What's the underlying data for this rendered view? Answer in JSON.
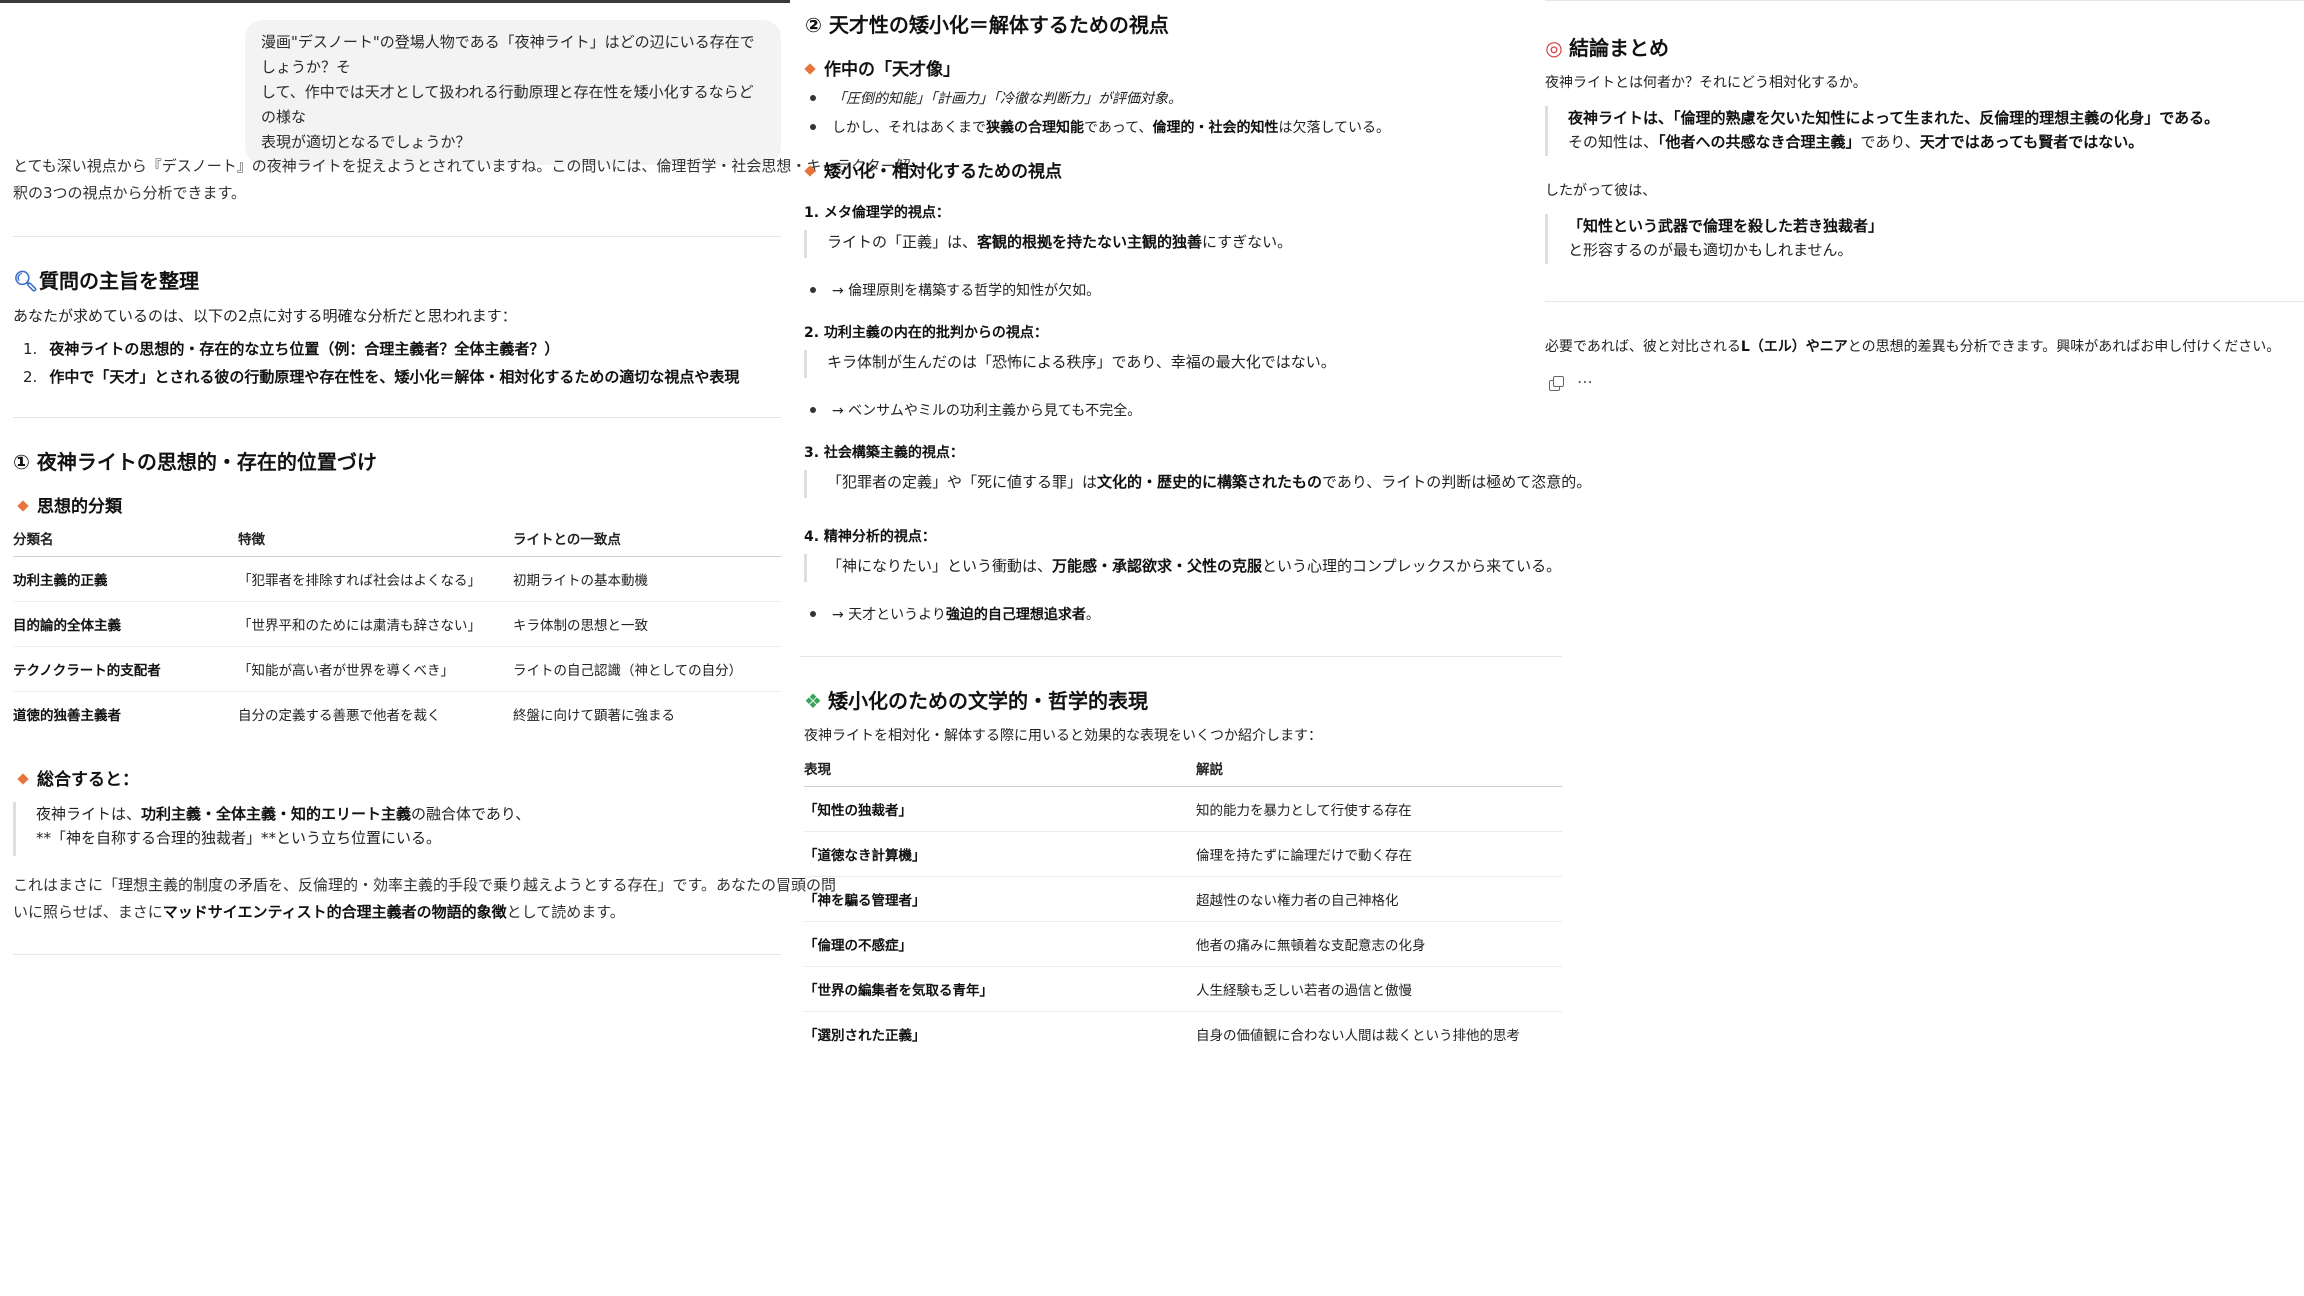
{
  "user_message": {
    "line1": "漫画\"デスノート\"の登場人物である「夜神ライト」はどの辺にいる存在でしょうか？そ",
    "line2": "して、作中では天才として扱われる行動原理と存在性を矮小化するならどの様な",
    "line3": "表現が適切となるでしょうか？"
  },
  "intro": {
    "line1": "とても深い視点から『デスノート』の夜神ライトを捉えようとされていますね。この問いには、倫理哲学・社会思想・キャラクター解",
    "line2": "釈の3つの視点から分析できます。"
  },
  "section_purpose": {
    "title": "質問の主旨を整理",
    "icon": "search-icon",
    "lead": "あなたが求めているのは、以下の2点に対する明確な分析だと思われます：",
    "items": [
      {
        "num": "1.",
        "text": "夜神ライトの思想的・存在的な立ち位置（例：合理主義者？全体主義者？）"
      },
      {
        "num": "2.",
        "text": "作中で「天才」とされる彼の行動原理や存在性を、矮小化＝解体・相対化するための適切な視点や表現"
      }
    ]
  },
  "section1": {
    "title": "① 夜神ライトの思想的・存在的位置づけ",
    "sub1": "思想的分類",
    "table": {
      "headers": [
        "分類名",
        "特徴",
        "ライトとの一致点"
      ],
      "rows": [
        [
          "功利主義的正義",
          "「犯罪者を排除すれば社会はよくなる」",
          "初期ライトの基本動機"
        ],
        [
          "目的論的全体主義",
          "「世界平和のためには粛清も辞さない」",
          "キラ体制の思想と一致"
        ],
        [
          "テクノクラート的支配者",
          "「知能が高い者が世界を導くべき」",
          "ライトの自己認識（神としての自分）"
        ],
        [
          "道徳的独善主義者",
          "自分の定義する善悪で他者を裁く",
          "終盤に向けて顕著に強まる"
        ]
      ]
    },
    "sub2": "総合すると：",
    "quote": {
      "prefix": "夜神ライトは、",
      "bold": "功利主義・全体主義・知的エリート主義",
      "suffix": "の融合体であり、",
      "line2": "**「神を自称する合理的独裁者」**という立ち位置にいる。"
    },
    "closing": {
      "line1": "これはまさに「理想主義的制度の矛盾を、反倫理的・効率主義的手段で乗り越えようとする存在」です。あなたの冒頭の問",
      "line2_pre": "いに照らせば、まさに",
      "line2_bold": "マッドサイエンティスト的合理主義者の物語的象徴",
      "line2_post": "として読めます。"
    }
  },
  "section2": {
    "title": "② 天才性の矮小化＝解体するための視点",
    "sub1": "作中の「天才像」",
    "bullet1": "「圧倒的知能」「計画力」「冷徹な判断力」が評価対象。",
    "bullet2_pre": "しかし、それはあくまで",
    "bullet2_b1": "狭義の合理知能",
    "bullet2_mid": "であって、",
    "bullet2_b2": "倫理的・社会的知性",
    "bullet2_post": "は欠落している。",
    "sub2": "矮小化・相対化するための視点",
    "v1": {
      "head": "1. メタ倫理学的視点：",
      "quote_pre": "ライトの「正義」は、",
      "quote_bold": "客観的根拠を持たない主観的独善",
      "quote_post": "にすぎない。",
      "bullet": "→ 倫理原則を構築する哲学的知性が欠如。"
    },
    "v2": {
      "head": "2. 功利主義の内在的批判からの視点：",
      "quote": "キラ体制が生んだのは「恐怖による秩序」であり、幸福の最大化ではない。",
      "bullet": "→ ベンサムやミルの功利主義から見ても不完全。"
    },
    "v3": {
      "head": "3. 社会構築主義的視点：",
      "quote_pre": "「犯罪者の定義」や「死に値する罪」は",
      "quote_bold": "文化的・歴史的に構築されたもの",
      "quote_post": "であり、ライトの判断は極めて恣意的。"
    },
    "v4": {
      "head": "4. 精神分析的視点：",
      "quote_pre": "「神になりたい」という衝動は、",
      "quote_bold": "万能感・承認欲求・父性の克服",
      "quote_post": "という心理的コンプレックスから来ている。",
      "bullet_pre": "→ 天才というより",
      "bullet_bold": "強迫的自己理想追求者",
      "bullet_post": "。"
    }
  },
  "section3": {
    "title": "矮小化のための文学的・哲学的表現",
    "icon": "puzzle-icon",
    "lead": "夜神ライトを相対化・解体する際に用いると効果的な表現をいくつか紹介します：",
    "table": {
      "headers": [
        "表現",
        "解説"
      ],
      "rows": [
        [
          "「知性の独裁者」",
          "知的能力を暴力として行使する存在"
        ],
        [
          "「道徳なき計算機」",
          "倫理を持たずに論理だけで動く存在"
        ],
        [
          "「神を騙る管理者」",
          "超越性のない権力者の自己神格化"
        ],
        [
          "「倫理の不感症」",
          "他者の痛みに無頓着な支配意志の化身"
        ],
        [
          "「世界の編集者を気取る青年」",
          "人生経験も乏しい若者の過信と傲慢"
        ],
        [
          "「選別された正義」",
          "自身の価値観に合わない人間は裁くという排他的思考"
        ]
      ]
    }
  },
  "conclusion": {
    "title": "結論まとめ",
    "icon": "target-icon",
    "lead": "夜神ライトとは何者か？それにどう相対化するか。",
    "q1_line1": "夜神ライトは、「倫理的熟慮を欠いた知性によって生まれた、反倫理的理想主義の化身」である。",
    "q1_line2_pre": "その知性は、",
    "q1_line2_bold": "「他者への共感なき合理主義」",
    "q1_line2_mid": "であり、",
    "q1_line2_bold2": "天才ではあっても賢者ではない。",
    "therefore": "したがって彼は、",
    "q2_line1": "「知性という武器で倫理を殺した若き独裁者」",
    "q2_line2": "と形容するのが最も適切かもしれません。",
    "offer_pre": "必要であれば、彼と対比される",
    "offer_bold": "L（エル）やニア",
    "offer_post": "との思想的差異も分析できます。興味があればお申し付けください。",
    "actions": {
      "copy_icon": "copy-icon",
      "more_label": "⋯"
    }
  }
}
